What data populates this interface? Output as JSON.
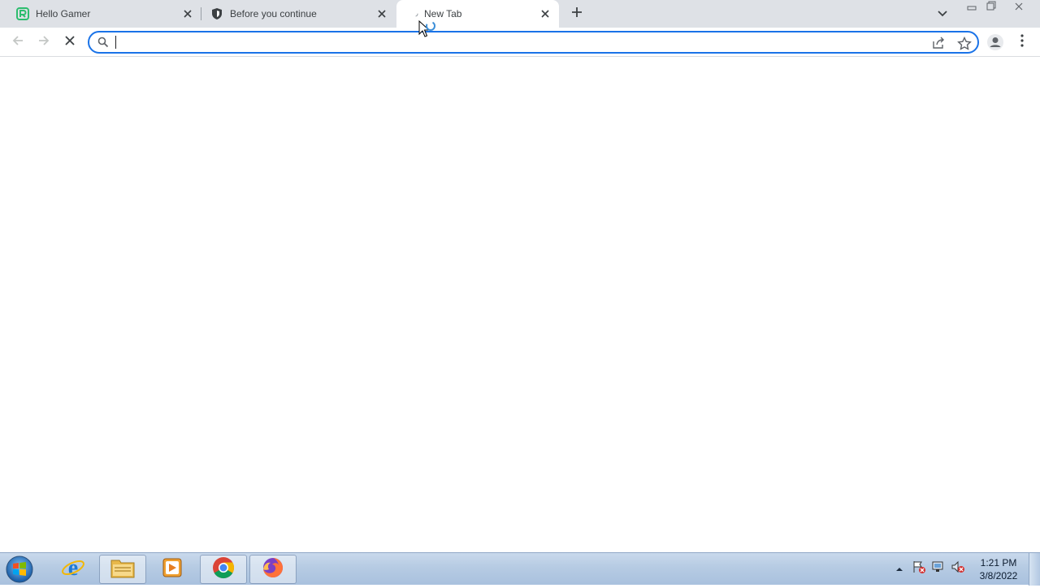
{
  "browser": {
    "tabs": [
      {
        "title": "Hello Gamer",
        "favicon": "green-r-logo-icon",
        "active": false
      },
      {
        "title": "Before you continue",
        "favicon": "shield-icon",
        "active": false
      },
      {
        "title": "New Tab",
        "favicon": "loading-spinner-icon",
        "active": true
      }
    ],
    "new_tab_icon": "plus-icon",
    "tab_search_icon": "chevron-down-icon",
    "window_controls": [
      "minimize-icon",
      "restore-icon",
      "close-icon"
    ]
  },
  "toolbar": {
    "back_icon": "arrow-left-icon",
    "forward_icon": "arrow-right-icon",
    "stop_icon": "close-icon",
    "omnibox": {
      "value": "",
      "placeholder": "",
      "focused": true,
      "accent": "#1a73e8"
    },
    "share_icon": "share-icon",
    "bookmark_icon": "star-icon",
    "profile_icon": "profile-icon",
    "menu_icon": "kebab-menu-icon"
  },
  "taskbar": {
    "apps": [
      {
        "name": "internet-explorer",
        "active": false
      },
      {
        "name": "file-explorer",
        "active": true
      },
      {
        "name": "media-player",
        "active": false
      },
      {
        "name": "chrome",
        "active": true
      },
      {
        "name": "firefox",
        "active": true
      }
    ],
    "tray_icons": [
      "show-hidden-icons-arrow",
      "action-center-flag-icon",
      "network-icon",
      "volume-muted-icon"
    ],
    "clock": {
      "time": "1:21 PM",
      "date": "3/8/2022"
    }
  },
  "colors": {
    "tabstrip_bg": "#dee1e6",
    "active_tab_bg": "#ffffff",
    "taskbar_bg": "#b6cbe3"
  }
}
